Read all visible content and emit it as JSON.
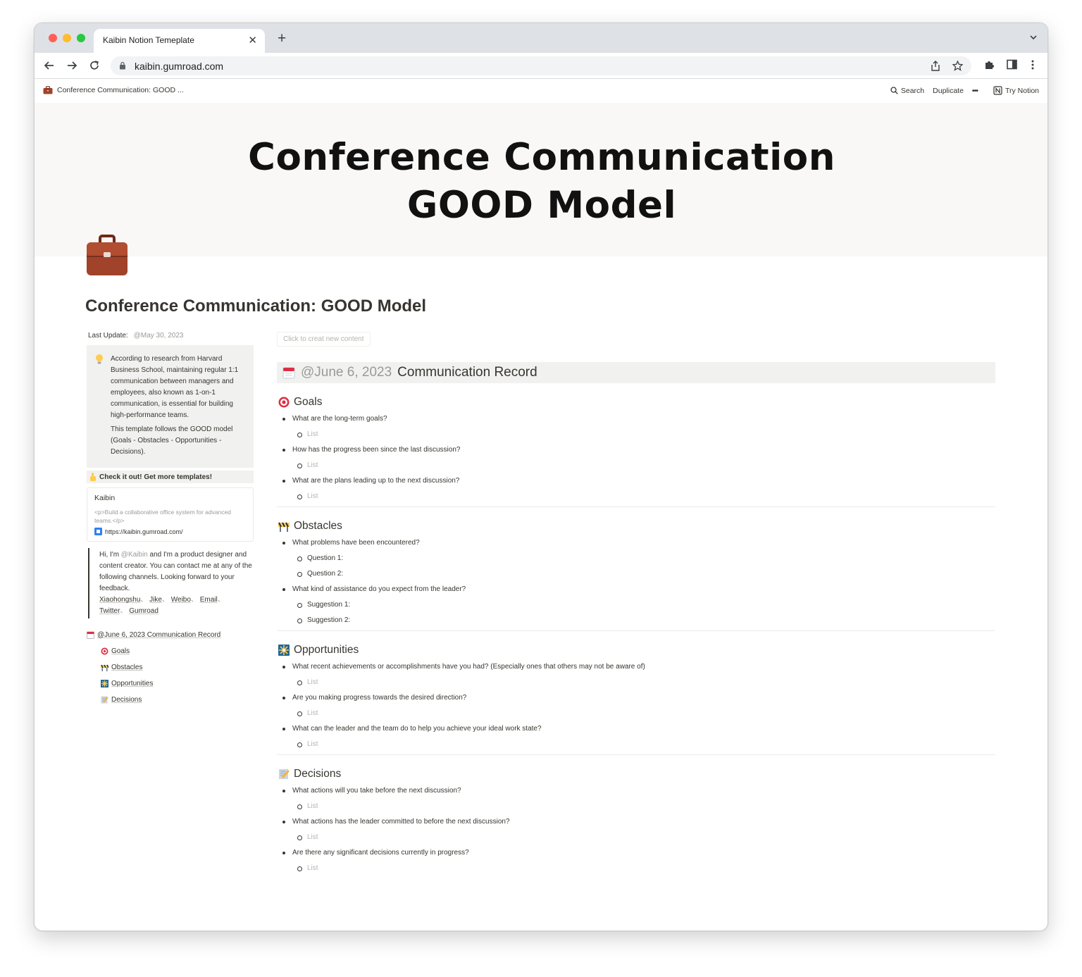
{
  "browser": {
    "tab_title": "Kaibin Notion Temeplate",
    "url": "kaibin.gumroad.com"
  },
  "topbar": {
    "breadcrumb": "Conference Communication: GOOD ...",
    "search": "Search",
    "duplicate": "Duplicate",
    "more": "•••",
    "try_notion": "Try Notion"
  },
  "cover": {
    "line1": "Conference Communication",
    "line2": "GOOD Model"
  },
  "page": {
    "title": "Conference Communication: GOOD Model"
  },
  "left": {
    "last_update_label": "Last Update:",
    "last_update_value": "@May 30, 2023",
    "callout_p1": "According to research from Harvard Business School, maintaining regular 1:1 communication between managers and employees, also known as 1-on-1 communication, is essential for building high-performance teams.",
    "callout_p2": "This template follows the GOOD model (Goals - Obstacles - Opportunities - Decisions).",
    "check_it_out": "Check it out! Get more templates!",
    "bookmark_title": "Kaibin",
    "bookmark_desc": "<p>Build a collaborative office system for advanced teams.</p>",
    "bookmark_url": "https://kaibin.gumroad.com/",
    "quote_pre": "Hi, I'm ",
    "quote_mention": "@Kaibin",
    "quote_post": " and I'm a product designer and content creator. You can contact me at any of the following channels. Looking forward to your feedback.",
    "links": [
      "Xiaohongshu",
      "Jike",
      "Weibo",
      "Email",
      "Twitter",
      "Gumroad"
    ],
    "link_sep": "、",
    "toc_main": "@June 6, 2023 Communication Record",
    "toc_items": [
      "Goals",
      "Obstacles",
      "Opportunities",
      "Decisions"
    ]
  },
  "right": {
    "new_content": "Click to creat new content",
    "record_date": "@June 6, 2023",
    "record_title": "Communication Record",
    "goals": {
      "title": "Goals",
      "q1": "What are the long-term goals?",
      "q2": "How has the progress been since the last discussion?",
      "q3": "What are the plans leading up to the next discussion?",
      "placeholder": "List"
    },
    "obstacles": {
      "title": "Obstacles",
      "q1": "What problems have been encountered?",
      "q1a": "Question 1:",
      "q1b": "Question 2:",
      "q2": "What kind of assistance do you expect from the leader?",
      "q2a": "Suggestion 1:",
      "q2b": "Suggestion 2:"
    },
    "opportunities": {
      "title": "Opportunities",
      "q1": "What recent achievements or accomplishments have you had? (Especially ones that others may not be aware of)",
      "q2": "Are you making progress towards the desired direction?",
      "q3": "What can the leader and the team do to help you achieve your ideal work state?",
      "placeholder": "List"
    },
    "decisions": {
      "title": "Decisions",
      "q1": "What actions will you take before the next discussion?",
      "q2": "What actions has the leader committed to before the next discussion?",
      "q3": "Are there any significant decisions currently in progress?",
      "placeholder": "List"
    }
  },
  "colors": {
    "traffic_red": "#ff5f57",
    "traffic_yellow": "#febc2e",
    "traffic_green": "#28c840",
    "tab_strip": "#dee1e6",
    "callout_bg": "#f1f1ef",
    "text": "#37352f",
    "muted": "#9b9a97"
  },
  "icons": {
    "page": "briefcase-icon",
    "callout": "lightbulb-icon",
    "check": "pointing-finger-icon",
    "record": "calendar-icon",
    "goals": "target-icon",
    "obstacles": "barrier-icon",
    "opportunities": "sparkler-icon",
    "decisions": "memo-icon"
  }
}
